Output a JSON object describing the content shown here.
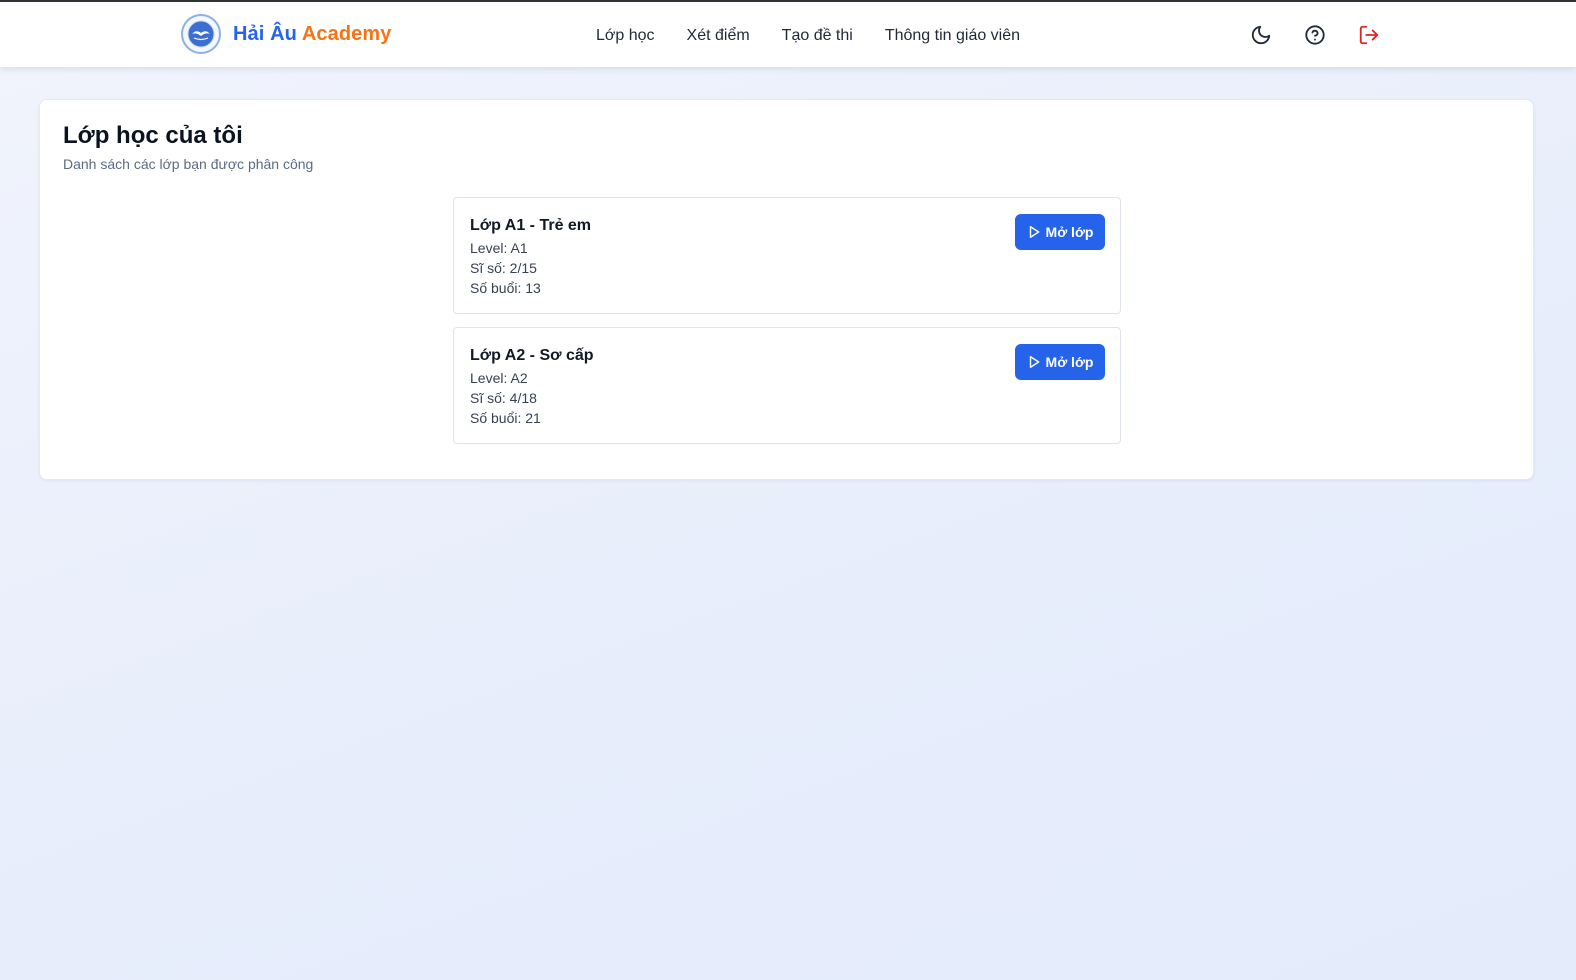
{
  "brand": {
    "name_part1": "Hải Âu",
    "name_part2": "Academy",
    "logo_icon": "seagull-logo-icon"
  },
  "colors": {
    "brand_blue": "#2563eb",
    "brand_orange": "#f97316",
    "logout_red": "#dc2626",
    "button_blue": "#2563eb"
  },
  "nav": {
    "items": [
      {
        "label": "Lớp học"
      },
      {
        "label": "Xét điểm"
      },
      {
        "label": "Tạo đề thi"
      },
      {
        "label": "Thông tin giáo viên"
      }
    ]
  },
  "actions": {
    "icons": [
      "moon-icon",
      "help-circle-icon",
      "logout-icon"
    ]
  },
  "main": {
    "title": "Lớp học của tôi",
    "subtitle": "Danh sách các lớp bạn được phân công",
    "classes": [
      {
        "name": "Lớp A1 - Trẻ em",
        "level": "Level: A1",
        "size": "Sĩ số: 2/15",
        "sessions": "Số buổi: 13",
        "button": "Mở lớp"
      },
      {
        "name": "Lớp A2 - Sơ cấp",
        "level": "Level: A2",
        "size": "Sĩ số: 4/18",
        "sessions": "Số buổi: 21",
        "button": "Mở lớp"
      }
    ]
  }
}
